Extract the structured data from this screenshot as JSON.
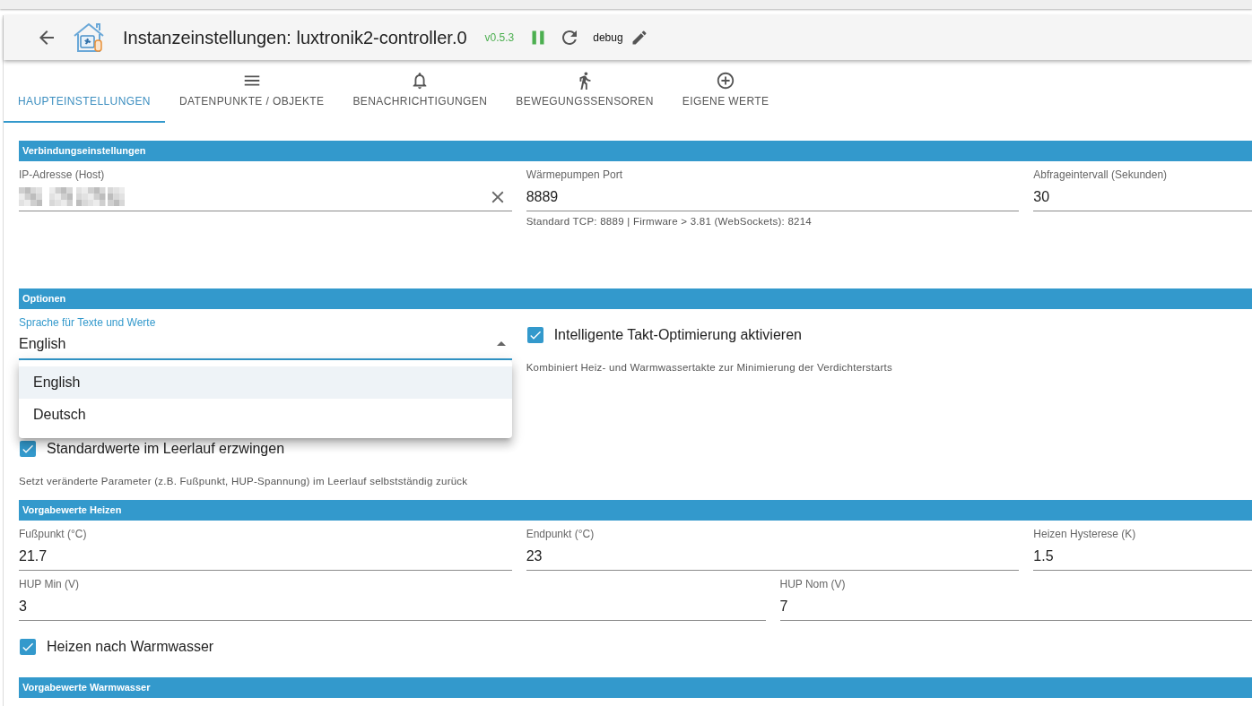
{
  "header": {
    "title": "Instanzeinstellungen: luxtronik2-controller.0",
    "version": "v0.5.3",
    "running": true,
    "log_level": "debug"
  },
  "tabs": [
    {
      "label": "HAUPTEINSTELLUNGEN",
      "selected": true
    },
    {
      "label": "DATENPUNKTE / OBJEKTE",
      "selected": false
    },
    {
      "label": "BENACHRICHTIGUNGEN",
      "selected": false
    },
    {
      "label": "BEWEGUNGSSENSOREN",
      "selected": false
    },
    {
      "label": "EIGENE WERTE",
      "selected": false
    }
  ],
  "sections": [
    {
      "title": "Verbindungseinstellungen",
      "items": [
        {
          "kind": "fields",
          "fields": [
            {
              "kind": "text",
              "label": "IP-Adresse (Host)",
              "redacted": true,
              "clearable": true
            },
            {
              "kind": "text",
              "label": "Wärmepumpen Port",
              "value": "8889",
              "helper": "Standard TCP: 8889 | Firmware > 3.81 (WebSockets): 8214"
            },
            {
              "kind": "text",
              "label": "Abfrageintervall (Sekunden)",
              "value": "30"
            }
          ]
        }
      ]
    },
    {
      "title": "Optionen",
      "items": [
        {
          "kind": "fields",
          "fields": [
            {
              "kind": "select",
              "label": "Sprache für Texte und Werte",
              "value": "English",
              "focused": true,
              "expanded": true,
              "options": [
                {
                  "label": "English",
                  "selected": true
                },
                {
                  "label": "Deutsch",
                  "selected": false
                }
              ]
            },
            {
              "kind": "checkbox",
              "label": "Intelligente Takt-Optimierung aktivieren",
              "checked": true,
              "helper": "Kombiniert Heiz- und Warmwassertakte zur Minimierung der Verdichterstarts"
            }
          ]
        },
        {
          "kind": "checkbox",
          "label": "Standardwerte im Leerlauf erzwingen",
          "checked": true,
          "helper": "Setzt veränderte Parameter (z.B. Fußpunkt, HUP-Spannung) im Leerlauf selbstständig zurück"
        }
      ]
    },
    {
      "title": "Vorgabewerte Heizen",
      "items": [
        {
          "kind": "fields",
          "fields": [
            {
              "kind": "text",
              "label": "Fußpunkt (°C)",
              "value": "21.7"
            },
            {
              "kind": "text",
              "label": "Endpunkt (°C)",
              "value": "23"
            },
            {
              "kind": "text",
              "label": "Heizen Hysterese (K)",
              "value": "1.5"
            }
          ]
        },
        {
          "kind": "fields",
          "fields": [
            {
              "kind": "text",
              "label": "HUP Min (V)",
              "value": "3"
            },
            {
              "kind": "text",
              "label": "HUP Nom (V)",
              "value": "7"
            }
          ]
        },
        {
          "kind": "checkbox",
          "label": "Heizen nach Warmwasser",
          "checked": true
        }
      ]
    },
    {
      "title": "Vorgabewerte Warmwasser"
    }
  ]
}
